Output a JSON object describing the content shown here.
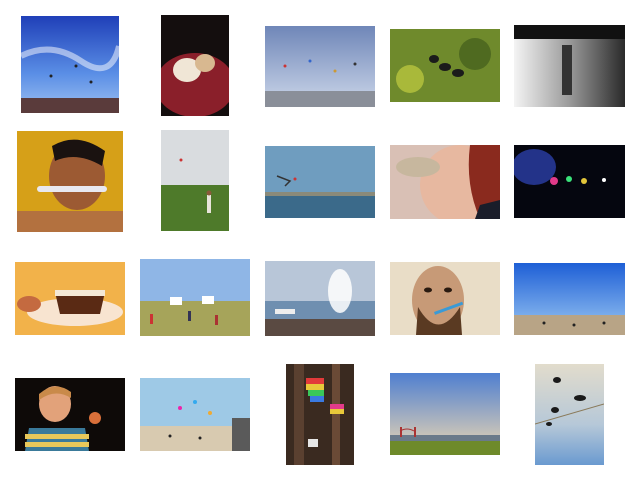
{
  "gallery": {
    "thumbnails": [
      {
        "subject": "kites-over-crowd-blue-sky"
      },
      {
        "subject": "food-closeup-red-plate"
      },
      {
        "subject": "kites-over-water-horizon"
      },
      {
        "subject": "ducklings-in-green-pond"
      },
      {
        "subject": "blurred-monochrome-street"
      },
      {
        "subject": "man-brushing-teeth-orange"
      },
      {
        "subject": "person-flying-kite-field"
      },
      {
        "subject": "kites-over-bay-shoreline"
      },
      {
        "subject": "woman-eating-closeup"
      },
      {
        "subject": "night-lights-dark-scene"
      },
      {
        "subject": "cake-slice-on-plate"
      },
      {
        "subject": "kite-festival-grass-field"
      },
      {
        "subject": "waterfront-crowd-pier"
      },
      {
        "subject": "bearded-man-brushing-teeth"
      },
      {
        "subject": "beach-crowd-blue-sky"
      },
      {
        "subject": "boy-striped-shirt"
      },
      {
        "subject": "kites-over-beach-boardwalk"
      },
      {
        "subject": "colorful-kite-tails-window"
      },
      {
        "subject": "bridge-green-park-sky"
      },
      {
        "subject": "birds-on-branches-sky"
      }
    ]
  }
}
